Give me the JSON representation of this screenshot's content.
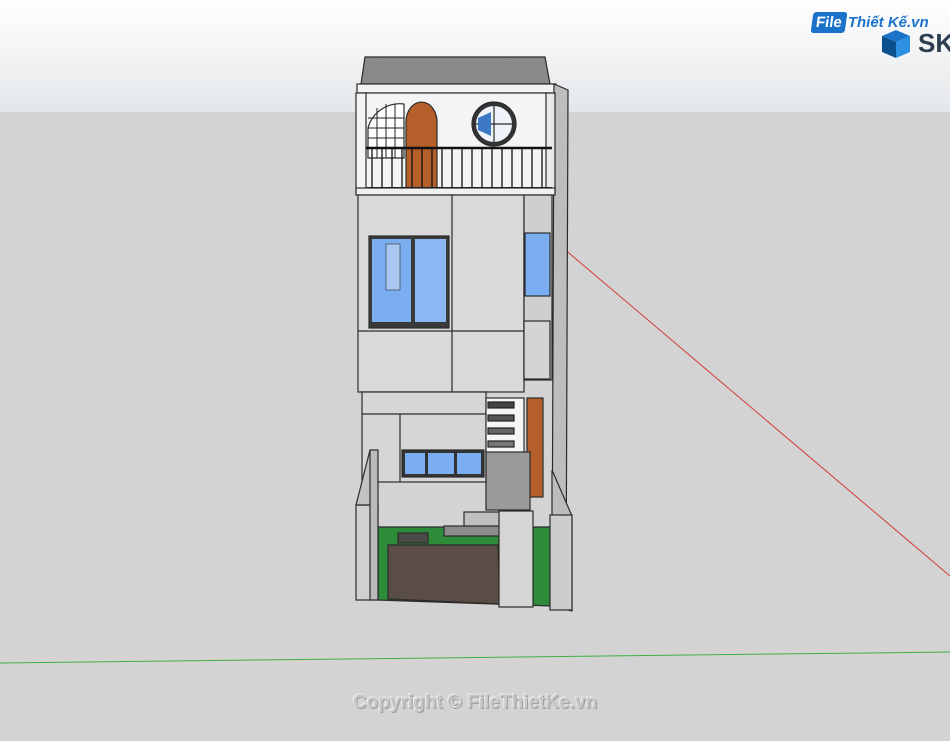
{
  "watermark": {
    "logo_box": "File",
    "logo_text": "Thiết Kế.vn",
    "app_brand": "SK",
    "copyright": "Copyright © FileThietKe.vn"
  },
  "colors": {
    "sky_top": "#ffffff",
    "sky_bottom": "#e4e7ea",
    "ground": "#d3d3d3",
    "red_axis": "#d23b3b",
    "green_axis": "#3cb043",
    "wall": "#dcdcdc",
    "glass": "#7aaef0",
    "wood": "#b5602a",
    "grass": "#2e8b3a",
    "paving": "#5a4d46",
    "roof": "#8a8a8a"
  },
  "icons": {
    "brand": "sketchup-logo-icon"
  }
}
